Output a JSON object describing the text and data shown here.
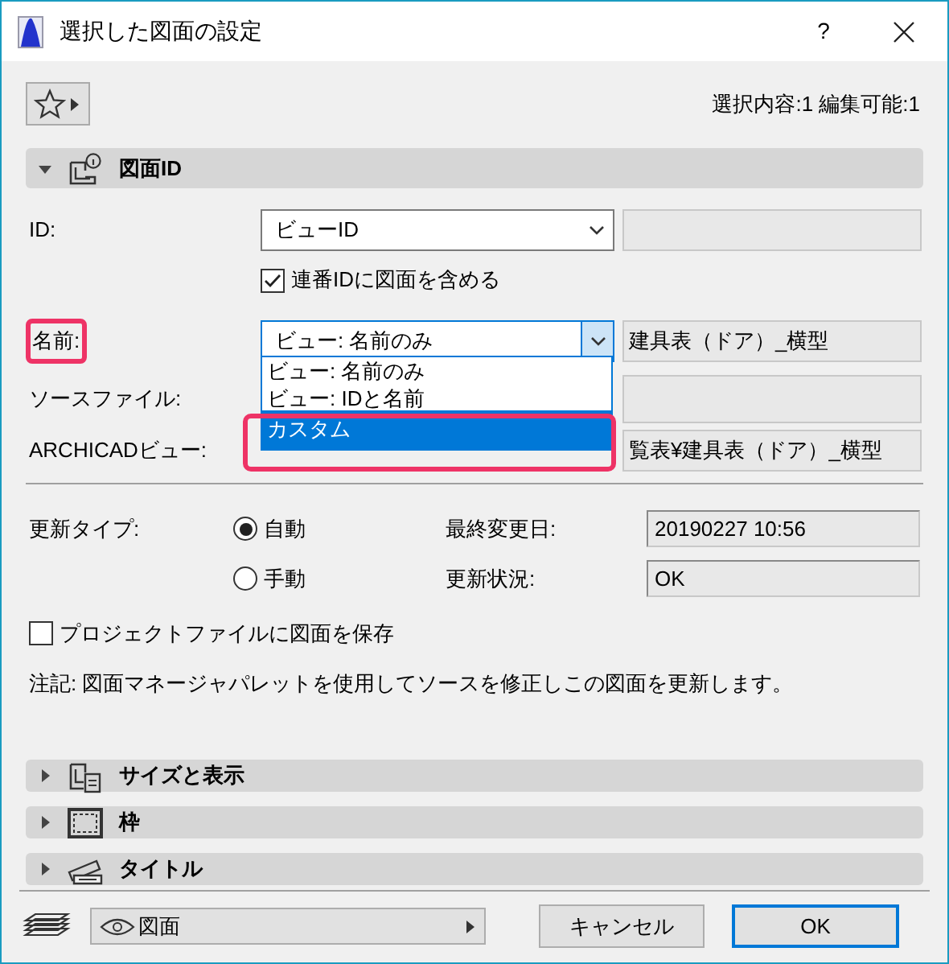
{
  "window": {
    "title": "選択した図面の設定",
    "help": "?"
  },
  "toolbar": {
    "selection_info": "選択内容:1 編集可能:1"
  },
  "sections": [
    {
      "kind": "id",
      "title": "図面ID",
      "expanded": true
    },
    {
      "kind": "size",
      "title": "サイズと表示",
      "expanded": false
    },
    {
      "kind": "frame",
      "title": "枠",
      "expanded": false
    },
    {
      "kind": "title",
      "title": "タイトル",
      "expanded": false
    }
  ],
  "drawing_id": {
    "id_label": "ID:",
    "id_value": "ビューID",
    "include_checkbox": {
      "label": "連番IDに図面を含める",
      "checked": true
    },
    "name_label": {
      "text": "名前:",
      "highlighted": true
    },
    "name_value": "ビュー: 名前のみ",
    "name_text": "建具表（ドア）_横型",
    "source_label": "ソースファイル:",
    "view_label": "ARCHICADビュー:",
    "view_text": "覧表¥建具表（ドア）_横型",
    "name_options": [
      {
        "label": "ビュー: 名前のみ",
        "selected": false,
        "highlighted": false
      },
      {
        "label": "ビュー: IDと名前",
        "selected": false,
        "highlighted": false
      },
      {
        "label": "カスタム",
        "selected": true,
        "highlighted": true
      }
    ],
    "update_type_label": "更新タイプ:",
    "update_types": [
      {
        "label": "自動",
        "selected": true
      },
      {
        "label": "手動",
        "selected": false
      }
    ],
    "info": [
      {
        "label": "最終変更日:",
        "value": "20190227 10:56"
      },
      {
        "label": "更新状況:",
        "value": "OK"
      }
    ],
    "save_checkbox": {
      "label": "プロジェクトファイルに図面を保存",
      "checked": false
    },
    "note": "注記: 図面マネージャパレットを使用してソースを修正しこの図面を更新します。"
  },
  "footer": {
    "layer_menu": "図面",
    "buttons": [
      {
        "label": "キャンセル",
        "default": false
      },
      {
        "label": "OK",
        "default": true
      }
    ]
  }
}
